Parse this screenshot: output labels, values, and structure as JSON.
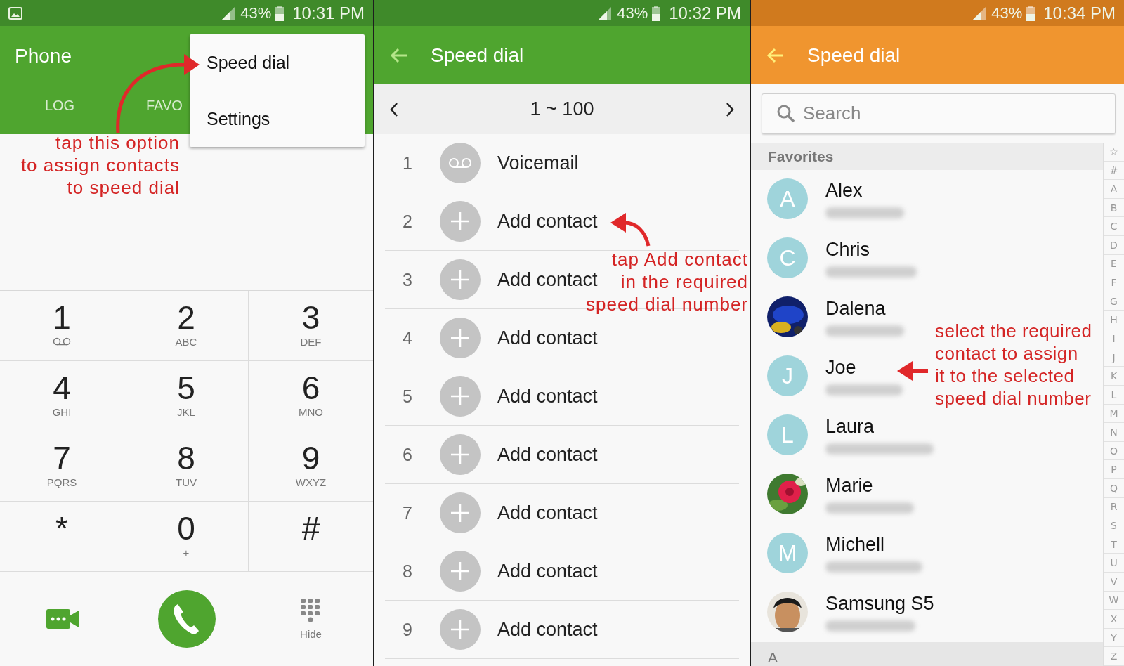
{
  "panels": [
    {
      "kind": "dialer",
      "status": {
        "photo_notification": true,
        "battery": "43%",
        "time": "10:31 PM"
      },
      "title": "Phone",
      "tabs": [
        {
          "label": "LOG"
        },
        {
          "label": "FAVO"
        }
      ],
      "menu": [
        {
          "label": "Speed dial"
        },
        {
          "label": "Settings"
        }
      ],
      "keys": [
        {
          "digit": "1",
          "kind": "voicemail"
        },
        {
          "digit": "2",
          "letters": "ABC"
        },
        {
          "digit": "3",
          "letters": "DEF"
        },
        {
          "digit": "4",
          "letters": "GHI"
        },
        {
          "digit": "5",
          "letters": "JKL"
        },
        {
          "digit": "6",
          "letters": "MNO"
        },
        {
          "digit": "7",
          "letters": "PQRS"
        },
        {
          "digit": "8",
          "letters": "TUV"
        },
        {
          "digit": "9",
          "letters": "WXYZ"
        },
        {
          "digit": "*"
        },
        {
          "digit": "0",
          "letters": "+"
        },
        {
          "digit": "#"
        }
      ],
      "hide_label": "Hide",
      "annotation": [
        "tap this option",
        "to assign contacts",
        "to speed dial"
      ]
    },
    {
      "kind": "speed_dial",
      "status": {
        "photo_notification": false,
        "battery": "43%",
        "time": "10:32 PM"
      },
      "title": "Speed dial",
      "range": "1 ~ 100",
      "rows": [
        {
          "number": "1",
          "kind": "voicemail",
          "label": "Voicemail"
        },
        {
          "number": "2",
          "kind": "add",
          "label": "Add contact"
        },
        {
          "number": "3",
          "kind": "add",
          "label": "Add contact"
        },
        {
          "number": "4",
          "kind": "add",
          "label": "Add contact"
        },
        {
          "number": "5",
          "kind": "add",
          "label": "Add contact"
        },
        {
          "number": "6",
          "kind": "add",
          "label": "Add contact"
        },
        {
          "number": "7",
          "kind": "add",
          "label": "Add contact"
        },
        {
          "number": "8",
          "kind": "add",
          "label": "Add contact"
        },
        {
          "number": "9",
          "kind": "add",
          "label": "Add contact"
        }
      ],
      "annotation": [
        "tap Add contact",
        "in the required",
        "speed dial number"
      ]
    },
    {
      "kind": "contact_picker",
      "status": {
        "photo_notification": false,
        "battery": "43%",
        "time": "10:34 PM"
      },
      "title": "Speed dial",
      "search": {
        "placeholder": "Search"
      },
      "section": "Favorites",
      "contacts": [
        {
          "name": "Alex",
          "kind": "letter",
          "initial": "A"
        },
        {
          "name": "Chris",
          "kind": "letter",
          "initial": "C"
        },
        {
          "name": "Dalena"
        },
        {
          "name": "Joe",
          "kind": "letter",
          "initial": "J"
        },
        {
          "name": "Laura",
          "kind": "letter",
          "initial": "L"
        },
        {
          "name": "Marie"
        },
        {
          "name": "Michell",
          "kind": "letter",
          "initial": "M"
        },
        {
          "name": "Samsung S5"
        }
      ],
      "next_section": "A",
      "index": [
        "☆",
        "#",
        "A",
        "B",
        "C",
        "D",
        "E",
        "F",
        "G",
        "H",
        "I",
        "J",
        "K",
        "L",
        "M",
        "N",
        "O",
        "P",
        "Q",
        "R",
        "S",
        "T",
        "U",
        "V",
        "W",
        "X",
        "Y",
        "Z"
      ],
      "annotation": [
        "select the required",
        "contact to assign",
        "it to the selected",
        "speed dial number"
      ]
    }
  ]
}
